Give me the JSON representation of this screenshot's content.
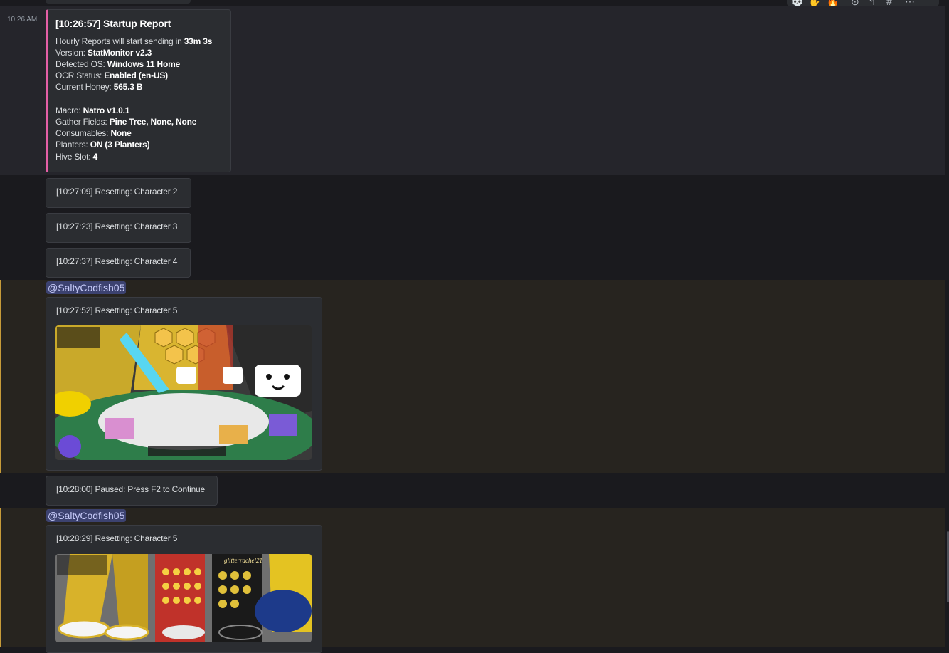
{
  "header_icons": [
    "skull-icon",
    "hand-icon",
    "fire-icon",
    "edit-icon",
    "reply-icon",
    "thread-icon",
    "more-icon"
  ],
  "report": {
    "timestamp": "10:26 AM",
    "title": "[10:26:57] Startup Report",
    "hourly_prefix": "Hourly Reports will start sending in ",
    "hourly_value": "33m 3s",
    "version_label": "Version: ",
    "version_value": "StatMonitor v2.3",
    "os_label": "Detected OS: ",
    "os_value": "Windows 11 Home",
    "ocr_label": "OCR Status: ",
    "ocr_value": "Enabled (en-US)",
    "honey_label": "Current Honey: ",
    "honey_value": "565.3 B",
    "macro_label": "Macro: ",
    "macro_value": "Natro v1.0.1",
    "fields_label": "Gather Fields: ",
    "fields_value": "Pine Tree, None, None",
    "consumables_label": "Consumables: ",
    "consumables_value": "None",
    "planters_label": "Planters: ",
    "planters_value": "ON (3 Planters)",
    "hive_label": "Hive Slot: ",
    "hive_value": "4"
  },
  "reset_messages": [
    "[10:27:09] Resetting: Character 2",
    "[10:27:23] Resetting: Character 3",
    "[10:27:37] Resetting: Character 4"
  ],
  "mention1": {
    "mention": "@SaltyCodfish05",
    "text": "[10:27:52] Resetting: Character 5"
  },
  "paused": "[10:28:00] Paused: Press F2 to Continue",
  "mention2": {
    "mention": "@SaltyCodfish05",
    "text": "[10:28:29] Resetting: Character 5",
    "player_name": "glitterrachel21"
  },
  "colors": {
    "accent_pink": "#e45fa6",
    "mention_bar": "#c79b39",
    "mention_pill": "#3c4270"
  }
}
